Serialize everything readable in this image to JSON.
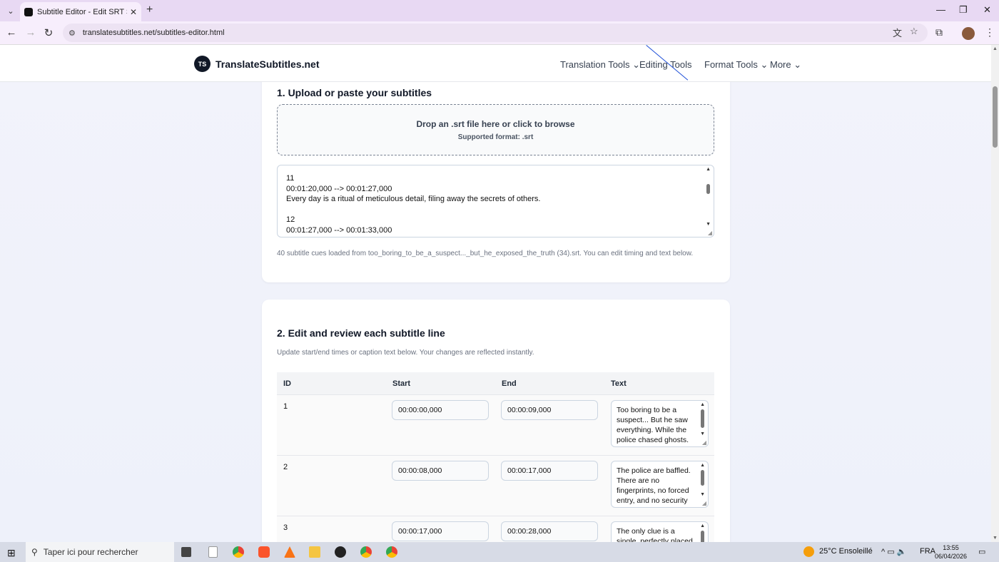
{
  "browser": {
    "tab_title": "Subtitle Editor - Edit SRT Subtitles",
    "url": "translatesubtitles.net/subtitles-editor.html"
  },
  "site": {
    "logo_badge": "TS",
    "logo_text": "TranslateSubtitles.net",
    "nav": [
      {
        "label": "Translation Tools ⌄"
      },
      {
        "label": "Editing Tools"
      },
      {
        "label": "Format Tools ⌄"
      },
      {
        "label": "More ⌄"
      }
    ]
  },
  "upload": {
    "title": "1. Upload or paste your subtitles",
    "drop_label": "Drop an .srt file here or click to browse",
    "supported": "Supported format: .srt",
    "srt_lines": [
      "11",
      "00:01:20,000 --> 00:01:27,000",
      "Every day is a ritual of meticulous detail, filing away the secrets of others.",
      "",
      "12",
      "00:01:27,000 --> 00:01:33,000"
    ],
    "loaded_info": "40 subtitle cues loaded from too_boring_to_be_a_suspect..._but_he_exposed_the_truth (34).srt. You can edit timing and text below."
  },
  "editor": {
    "title": "2. Edit and review each subtitle line",
    "subtitle": "Update start/end times or caption text below. Your changes are reflected instantly.",
    "headers": {
      "id": "ID",
      "start": "Start",
      "end": "End",
      "text": "Text"
    },
    "rows": [
      {
        "id": "1",
        "start": "00:00:00,000",
        "end": "00:00:09,000",
        "text": "Too boring to be a suspect... But he saw everything. While the police chased ghosts."
      },
      {
        "id": "2",
        "start": "00:00:08,000",
        "end": "00:00:17,000",
        "text": "The police are baffled. There are no fingerprints, no forced entry, and no security"
      },
      {
        "id": "3",
        "start": "00:00:17,000",
        "end": "00:00:28,000",
        "text": "The only clue is a single, perfectly placed"
      }
    ]
  },
  "taskbar": {
    "search_placeholder": "Taper ici pour rechercher",
    "weather": "25°C  Ensoleillé",
    "lang": "FRA",
    "time": "13:55",
    "date": "06/04/2026"
  },
  "colors": {
    "tab_strip": "#e8d9f3",
    "accent_line": "#1d4ed8",
    "page_bg": "#eef0fa"
  }
}
